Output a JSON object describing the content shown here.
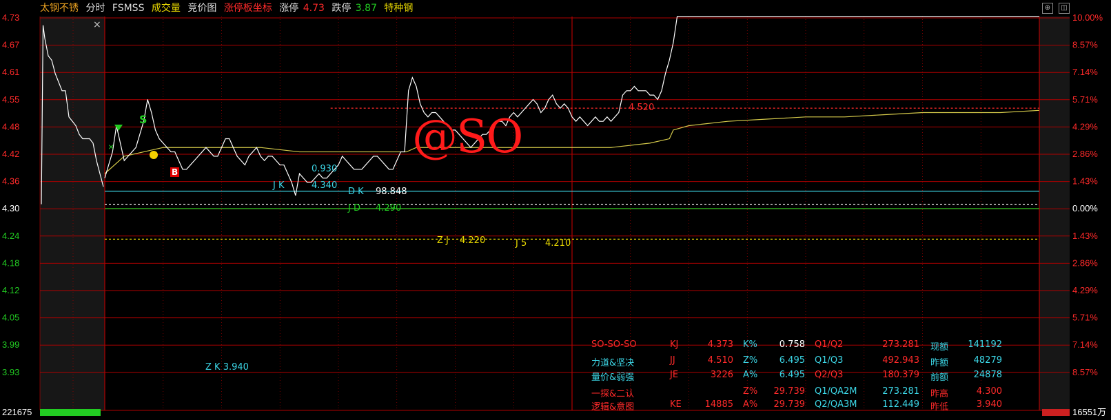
{
  "header": {
    "stock_name": "太钢不锈",
    "mode": "分时",
    "indicator": "FSMSS",
    "volume_label": "成交量",
    "auction_label": "竞价图",
    "limit_axis_label": "涨停板坐标",
    "limit_up_label": "涨停",
    "limit_up_value": "4.73",
    "limit_down_label": "跌停",
    "limit_down_value": "3.87",
    "sector": "特种钢",
    "close_mark": "×"
  },
  "watermark": "@SO",
  "colors": {
    "price_line": "#ffffff",
    "avg_line": "#d4c94a",
    "grid": "#b00000",
    "up": "#ff2a2a",
    "down": "#22cc22",
    "cyan": "#3cd6e6",
    "yellow": "#e8d800"
  },
  "chart_data": {
    "type": "line",
    "prev_close": 4.3,
    "ylim": [
      3.87,
      4.73
    ],
    "left_ticks": [
      "4.73",
      "4.67",
      "4.61",
      "4.55",
      "4.48",
      "4.42",
      "4.36",
      "4.30",
      "4.24",
      "4.18",
      "4.12",
      "4.05",
      "3.99",
      "3.93"
    ],
    "right_ticks": [
      "10.00%",
      "8.57%",
      "7.14%",
      "5.71%",
      "4.29%",
      "2.86%",
      "1.43%",
      "0.00%",
      "1.43%",
      "2.86%",
      "4.29%",
      "5.71%",
      "7.14%",
      "8.57%"
    ],
    "volume_left": "221675",
    "volume_right": "16551万",
    "price": [
      [
        0,
        4.36
      ],
      [
        4,
        4.42
      ],
      [
        6,
        4.48
      ],
      [
        8,
        4.44
      ],
      [
        10,
        4.4
      ],
      [
        12,
        4.41
      ],
      [
        14,
        4.42
      ],
      [
        16,
        4.43
      ],
      [
        18,
        4.46
      ],
      [
        20,
        4.49
      ],
      [
        22,
        4.54
      ],
      [
        24,
        4.51
      ],
      [
        26,
        4.47
      ],
      [
        28,
        4.45
      ],
      [
        30,
        4.44
      ],
      [
        32,
        4.43
      ],
      [
        34,
        4.42
      ],
      [
        36,
        4.42
      ],
      [
        38,
        4.4
      ],
      [
        40,
        4.38
      ],
      [
        42,
        4.38
      ],
      [
        44,
        4.39
      ],
      [
        46,
        4.4
      ],
      [
        48,
        4.41
      ],
      [
        50,
        4.42
      ],
      [
        52,
        4.43
      ],
      [
        54,
        4.42
      ],
      [
        56,
        4.41
      ],
      [
        58,
        4.41
      ],
      [
        60,
        4.43
      ],
      [
        62,
        4.45
      ],
      [
        64,
        4.45
      ],
      [
        66,
        4.43
      ],
      [
        68,
        4.41
      ],
      [
        70,
        4.4
      ],
      [
        72,
        4.39
      ],
      [
        74,
        4.41
      ],
      [
        76,
        4.42
      ],
      [
        78,
        4.43
      ],
      [
        80,
        4.41
      ],
      [
        82,
        4.4
      ],
      [
        84,
        4.41
      ],
      [
        86,
        4.41
      ],
      [
        88,
        4.4
      ],
      [
        90,
        4.39
      ],
      [
        92,
        4.39
      ],
      [
        94,
        4.37
      ],
      [
        96,
        4.35
      ],
      [
        98,
        4.32
      ],
      [
        100,
        4.37
      ],
      [
        102,
        4.36
      ],
      [
        104,
        4.35
      ],
      [
        106,
        4.35
      ],
      [
        108,
        4.36
      ],
      [
        110,
        4.37
      ],
      [
        112,
        4.36
      ],
      [
        114,
        4.36
      ],
      [
        116,
        4.37
      ],
      [
        118,
        4.38
      ],
      [
        120,
        4.39
      ],
      [
        122,
        4.41
      ],
      [
        124,
        4.4
      ],
      [
        126,
        4.39
      ],
      [
        128,
        4.38
      ],
      [
        130,
        4.38
      ],
      [
        132,
        4.38
      ],
      [
        134,
        4.39
      ],
      [
        136,
        4.4
      ],
      [
        138,
        4.41
      ],
      [
        140,
        4.41
      ],
      [
        142,
        4.4
      ],
      [
        144,
        4.39
      ],
      [
        146,
        4.38
      ],
      [
        148,
        4.38
      ],
      [
        150,
        4.4
      ],
      [
        152,
        4.42
      ],
      [
        154,
        4.42
      ],
      [
        156,
        4.56
      ],
      [
        158,
        4.59
      ],
      [
        160,
        4.57
      ],
      [
        162,
        4.53
      ],
      [
        164,
        4.51
      ],
      [
        166,
        4.5
      ],
      [
        168,
        4.51
      ],
      [
        170,
        4.51
      ],
      [
        172,
        4.5
      ],
      [
        174,
        4.49
      ],
      [
        176,
        4.48
      ],
      [
        178,
        4.47
      ],
      [
        180,
        4.47
      ],
      [
        182,
        4.46
      ],
      [
        184,
        4.45
      ],
      [
        186,
        4.44
      ],
      [
        188,
        4.43
      ],
      [
        190,
        4.44
      ],
      [
        192,
        4.45
      ],
      [
        194,
        4.46
      ],
      [
        196,
        4.46
      ],
      [
        198,
        4.47
      ],
      [
        200,
        4.48
      ],
      [
        202,
        4.49
      ],
      [
        204,
        4.49
      ],
      [
        206,
        4.48
      ],
      [
        208,
        4.5
      ],
      [
        210,
        4.51
      ],
      [
        212,
        4.5
      ],
      [
        214,
        4.51
      ],
      [
        216,
        4.52
      ],
      [
        218,
        4.53
      ],
      [
        220,
        4.54
      ],
      [
        222,
        4.53
      ],
      [
        224,
        4.51
      ],
      [
        226,
        4.52
      ],
      [
        228,
        4.54
      ],
      [
        230,
        4.55
      ],
      [
        232,
        4.53
      ],
      [
        234,
        4.52
      ],
      [
        236,
        4.53
      ],
      [
        238,
        4.52
      ],
      [
        240,
        4.5
      ],
      [
        242,
        4.49
      ],
      [
        244,
        4.5
      ],
      [
        246,
        4.49
      ],
      [
        248,
        4.48
      ],
      [
        250,
        4.49
      ],
      [
        252,
        4.5
      ],
      [
        254,
        4.49
      ],
      [
        256,
        4.49
      ],
      [
        258,
        4.5
      ],
      [
        260,
        4.49
      ],
      [
        262,
        4.5
      ],
      [
        264,
        4.51
      ],
      [
        266,
        4.55
      ],
      [
        268,
        4.56
      ],
      [
        270,
        4.56
      ],
      [
        272,
        4.57
      ],
      [
        274,
        4.56
      ],
      [
        276,
        4.56
      ],
      [
        278,
        4.56
      ],
      [
        280,
        4.55
      ],
      [
        282,
        4.55
      ],
      [
        284,
        4.54
      ],
      [
        286,
        4.56
      ],
      [
        288,
        4.6
      ],
      [
        290,
        4.63
      ],
      [
        292,
        4.67
      ],
      [
        294,
        4.73
      ],
      [
        296,
        4.73
      ],
      [
        300,
        4.73
      ],
      [
        340,
        4.73
      ],
      [
        400,
        4.73
      ],
      [
        460,
        4.73
      ],
      [
        480,
        4.73
      ]
    ],
    "avg": [
      [
        0,
        4.37
      ],
      [
        10,
        4.41
      ],
      [
        20,
        4.42
      ],
      [
        30,
        4.43
      ],
      [
        40,
        4.43
      ],
      [
        60,
        4.43
      ],
      [
        80,
        4.43
      ],
      [
        100,
        4.42
      ],
      [
        120,
        4.42
      ],
      [
        140,
        4.42
      ],
      [
        155,
        4.42
      ],
      [
        160,
        4.43
      ],
      [
        180,
        4.43
      ],
      [
        200,
        4.43
      ],
      [
        220,
        4.43
      ],
      [
        240,
        4.43
      ],
      [
        260,
        4.43
      ],
      [
        280,
        4.44
      ],
      [
        290,
        4.45
      ],
      [
        292,
        4.47
      ],
      [
        300,
        4.48
      ],
      [
        320,
        4.49
      ],
      [
        340,
        4.495
      ],
      [
        360,
        4.5
      ],
      [
        380,
        4.5
      ],
      [
        400,
        4.505
      ],
      [
        420,
        4.51
      ],
      [
        440,
        4.51
      ],
      [
        460,
        4.51
      ],
      [
        480,
        4.515
      ]
    ],
    "pre_auction": [
      [
        0,
        4.3
      ],
      [
        1,
        4.71
      ],
      [
        2,
        4.68
      ],
      [
        4,
        4.64
      ],
      [
        6,
        4.63
      ],
      [
        8,
        4.6
      ],
      [
        10,
        4.58
      ],
      [
        12,
        4.56
      ],
      [
        14,
        4.56
      ],
      [
        16,
        4.5
      ],
      [
        18,
        4.49
      ],
      [
        20,
        4.48
      ],
      [
        22,
        4.46
      ],
      [
        24,
        4.45
      ],
      [
        26,
        4.45
      ],
      [
        28,
        4.45
      ],
      [
        30,
        4.44
      ],
      [
        32,
        4.4
      ],
      [
        34,
        4.37
      ],
      [
        36,
        4.34
      ]
    ],
    "hlines": [
      {
        "price": 4.33,
        "color": "#3cd6e6",
        "dashed": false
      },
      {
        "price": 4.3,
        "color": "#ffffff",
        "dashed": true
      },
      {
        "price": 4.29,
        "color": "#22cc22",
        "dashed": false
      },
      {
        "price": 4.22,
        "color": "#e8d800",
        "dashed": true
      },
      {
        "price": 4.52,
        "color": "#ff2a2a",
        "dashed": true,
        "from": 116
      }
    ],
    "labels": {
      "jk": "J K",
      "jk_val": "4.340",
      "dk": "D K",
      "dk_val": "98.848",
      "jd": "J D",
      "jd_val": "4.290",
      "zj": "Z J",
      "zj_val": "4.220",
      "j5": "J 5",
      "j5_val": "4.210",
      "zk": "Z K 3.940",
      "ref": "0.930",
      "red_line_val": "4.520",
      "s_mark": "S",
      "b_mark": "B"
    }
  },
  "stats": {
    "rows": [
      [
        "SO-SO-SO",
        "KJ",
        "4.373",
        "K%",
        "0.758",
        "Q1/Q2",
        "273.281",
        "现额",
        "141192"
      ],
      [
        "力道&坚决",
        "JJ",
        "4.510",
        "Z%",
        "6.495",
        "Q1/Q3",
        "492.943",
        "昨额",
        "48279"
      ],
      [
        "量价&弱强",
        "JE",
        "3226",
        "A%",
        "6.495",
        "Q2/Q3",
        "180.379",
        "前额",
        "24878"
      ],
      [
        "一探&二认",
        "",
        "",
        "Z%",
        "29.739",
        "Q1/QA2M",
        "273.281",
        "昨高",
        "4.300"
      ],
      [
        "逻辑&意图",
        "KE",
        "14885",
        "A%",
        "29.739",
        "Q2/QA3M",
        "112.449",
        "昨低",
        "3.940"
      ]
    ]
  }
}
